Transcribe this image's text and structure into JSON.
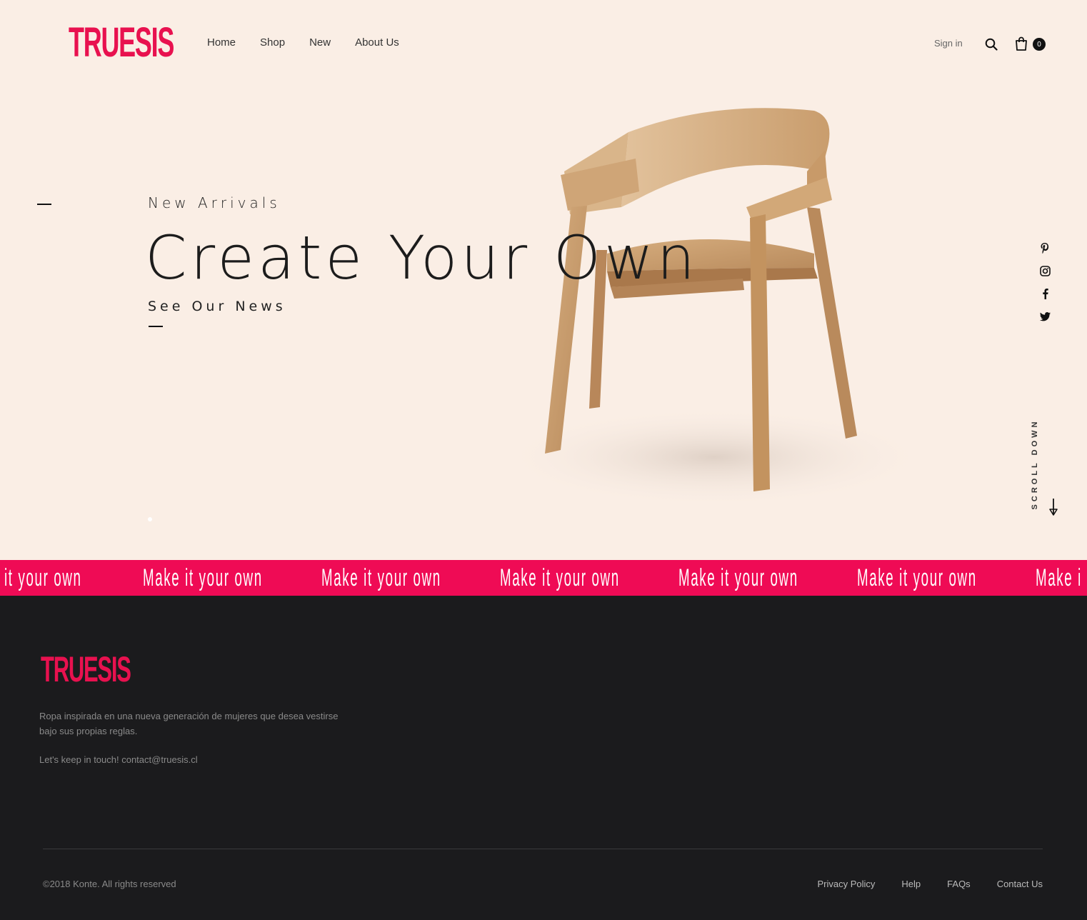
{
  "brand": {
    "logo_text": "TRUESIS",
    "accent_color": "#ef0b55"
  },
  "nav": {
    "items": [
      "Home",
      "Shop",
      "New",
      "About Us"
    ]
  },
  "header": {
    "signin_label": "Sign in",
    "cart_count": "0"
  },
  "hero": {
    "subtitle": "New Arrivals",
    "title": "Create Your Own",
    "link_label": "See Our News",
    "scroll_label": "SCROLL DOWN"
  },
  "social": {
    "icons": [
      "pinterest-icon",
      "instagram-icon",
      "facebook-icon",
      "twitter-icon"
    ]
  },
  "marquee": {
    "text_leading": "it your own",
    "text": "Make it your own",
    "text_trailing": "Make i"
  },
  "footer": {
    "logo_text": "TRUESIS",
    "description": "Ropa inspirada en una nueva generación de mujeres que desea vestirse bajo sus propias reglas.",
    "contact": "Let's keep in touch! contact@truesis.cl",
    "copyright": "©2018 Konte. All rights reserved",
    "links": [
      "Privacy Policy",
      "Help",
      "FAQs",
      "Contact Us"
    ]
  }
}
